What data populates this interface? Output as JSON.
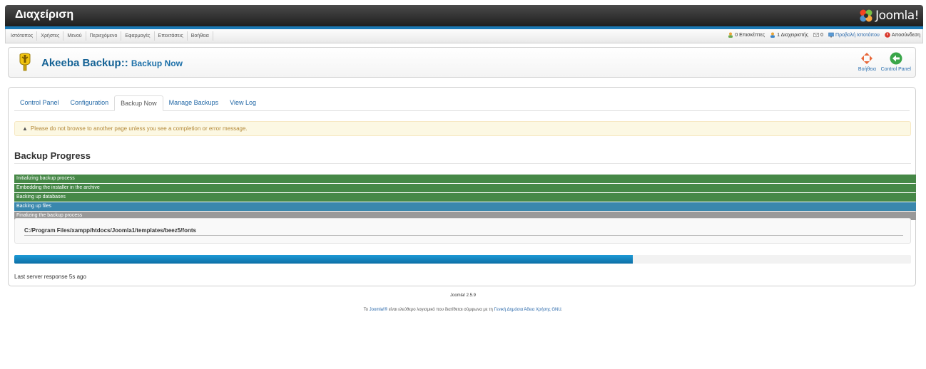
{
  "header": {
    "title": "Διαχείριση",
    "logo_text": "Joomla!"
  },
  "menu": {
    "items": [
      "Ιστότοπος",
      "Χρήστες",
      "Μενού",
      "Περιεχόμενο",
      "Εφαρμογές",
      "Επεκτάσεις",
      "Βοήθεια"
    ]
  },
  "status": {
    "visitors": "0 Επισκέπτες",
    "admins": "1 Διαχειριστής",
    "messages": "0",
    "view_site": "Προβολή Ιστοτόπου",
    "logout": "Αποσύνδεση"
  },
  "toolbar": {
    "title": "Akeeba Backup::",
    "subtitle": "Backup Now",
    "help_label": "Βοήθεια",
    "cpanel_label": "Control Panel"
  },
  "tabs": [
    "Control Panel",
    "Configuration",
    "Backup Now",
    "Manage Backups",
    "View Log"
  ],
  "active_tab": "Backup Now",
  "warning": "Please do not browse to another page unless you see a completion or error message.",
  "backup": {
    "heading": "Backup Progress",
    "steps": [
      {
        "label": "Initializing backup process",
        "state": "done"
      },
      {
        "label": "Embedding the installer in the archive",
        "state": "done"
      },
      {
        "label": "Backing up databases",
        "state": "done"
      },
      {
        "label": "Backing up files",
        "state": "active"
      },
      {
        "label": "Finalizing the backup process",
        "state": "pending"
      }
    ],
    "current_file": "C:/Program Files/xampp/htdocs/Joomla1/templates/beez5/fonts",
    "progress_percent": 69,
    "last_response": "Last server response 5s ago"
  },
  "footer": {
    "version": "Joomla! 2.5.9",
    "license_pre": "Το ",
    "license_link1": "Joomla!®",
    "license_mid": " είναι ελεύθερο λογισμικό που διατίθεται σύμφωνα με τη ",
    "license_link2": "Γενική Δημόσια Άδεια Χρήσης GNU",
    "license_post": "."
  },
  "colors": {
    "step_done": "#468847",
    "step_active": "#3a87ad",
    "step_pending": "#999999",
    "progress": "#1b8cc7",
    "link": "#2565a8"
  }
}
